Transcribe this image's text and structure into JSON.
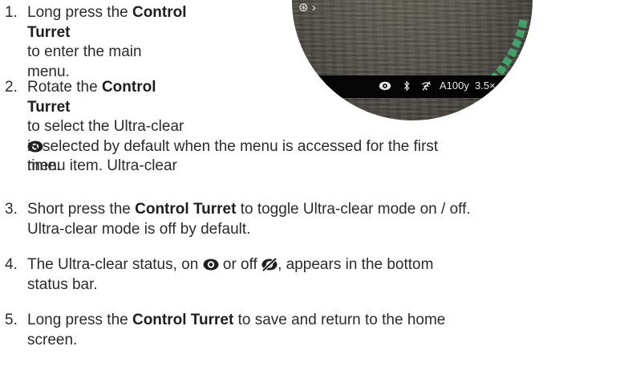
{
  "steps": [
    {
      "number": "1.",
      "line1_bold": "Control",
      "line1_pre": "Long press the ",
      "line2_bold": "Turret",
      "line2_post": " to enter the main",
      "line3": "menu."
    },
    {
      "number": "2.",
      "line1_pre": "Rotate the ",
      "line1_bold": "Control Turret",
      "line2": "to select the Ultra-clear",
      "line3_post": " menu item. Ultra-clear",
      "line4": "is selected by default when the menu is accessed for the first",
      "line5": "time."
    },
    {
      "number": "3.",
      "line1_pre": "Short press the ",
      "line1_bold": "Control Turret",
      "line1_post": " to toggle Ultra-clear mode on / off.",
      "line2": "Ultra-clear mode is off by default."
    },
    {
      "number": "4.",
      "line1_pre": "The Ultra-clear status, on ",
      "line1_mid": " or off ",
      "line1_post": ", appears in the bottom",
      "line2": "status bar."
    },
    {
      "number": "5.",
      "line1_pre": "Long press the ",
      "line1_bold": "Control Turret",
      "line1_post": " to save and return to the home",
      "line2": "screen."
    }
  ],
  "scope": {
    "range": "A100y",
    "zoom": "3.5×",
    "reticle_symbol": "⊛ ›",
    "icons": [
      "ultra-clear-on-icon",
      "bluetooth-icon",
      "wifi-off-icon",
      "reticle-icon"
    ],
    "dial_color": "#3fbf73"
  },
  "colors": {
    "text": "#2b2b2b",
    "bold": "#1e1e1e",
    "status_bar": "#050505"
  }
}
